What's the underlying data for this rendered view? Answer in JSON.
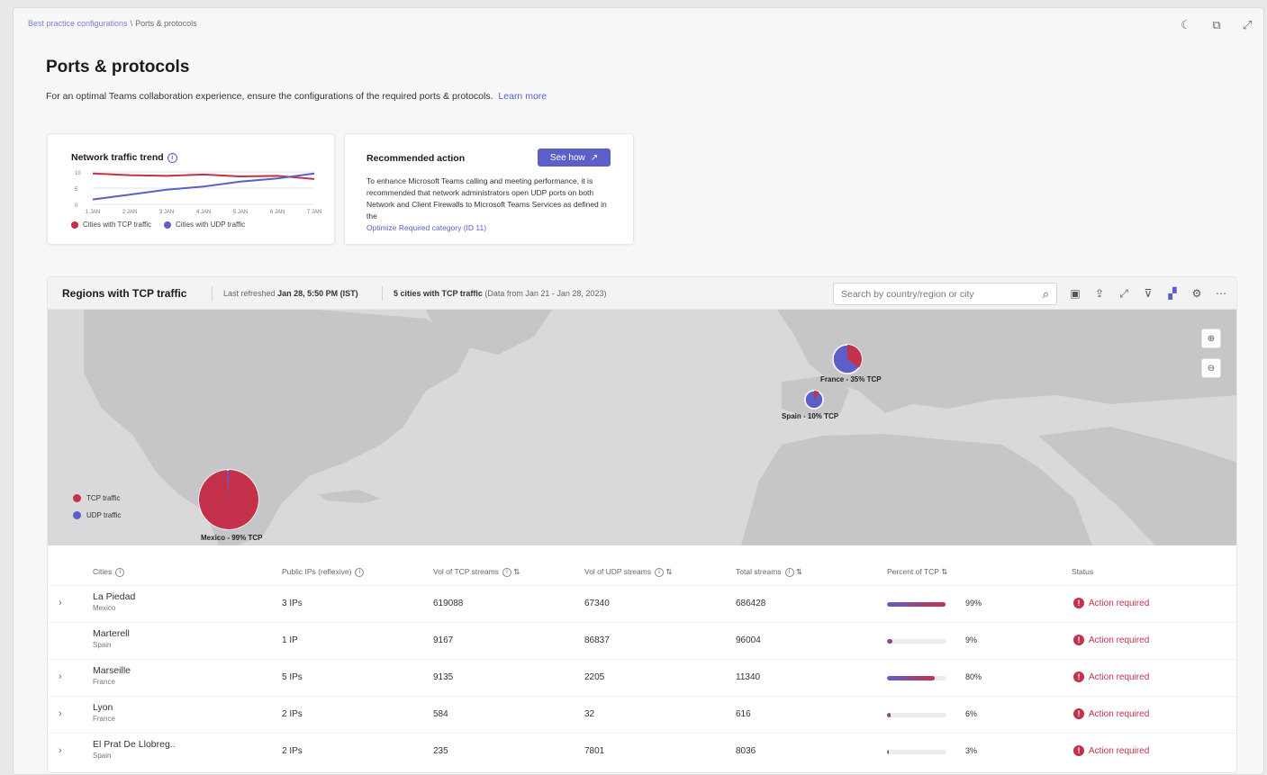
{
  "colors": {
    "tcp": "#c4314b",
    "udp": "#5b5fc7",
    "accent": "#5b5fc7"
  },
  "breadcrumb": {
    "parent": "Best practice configurations",
    "separator": "\\",
    "current": "Ports & protocols"
  },
  "window_icons": [
    "moon-icon",
    "restore-icon",
    "expand-icon"
  ],
  "page": {
    "title": "Ports & protocols",
    "description": "For an optimal Teams collaboration experience, ensure the configurations of the required ports & protocols.",
    "learn_more": "Learn more"
  },
  "trend_card": {
    "title": "Network traffic trend",
    "y_ticks": [
      "10",
      "5",
      "0"
    ],
    "x_ticks": [
      "1 JAN",
      "2 JAN",
      "3 JAN",
      "4 JAN",
      "5 JAN",
      "6 JAN",
      "7 JAN"
    ],
    "legend_tcp": "Cities with TCP traffic",
    "legend_udp": "Cities with UDP traffic"
  },
  "chart_data": {
    "type": "line",
    "title": "Network traffic trend",
    "x": [
      "1 JAN",
      "2 JAN",
      "3 JAN",
      "4 JAN",
      "5 JAN",
      "6 JAN",
      "7 JAN"
    ],
    "ylim": [
      0,
      10
    ],
    "series": [
      {
        "name": "Cities with TCP traffic",
        "values": [
          9.5,
          9.0,
          8.8,
          9.2,
          8.6,
          8.8,
          7.8
        ]
      },
      {
        "name": "Cities with UDP traffic",
        "values": [
          1.5,
          3.0,
          4.5,
          5.5,
          7.0,
          8.0,
          9.5
        ]
      }
    ]
  },
  "rec_card": {
    "title": "Recommended action",
    "button": "See how",
    "text": "To enhance Microsoft Teams calling and meeting performance, it is recommended that network administrators open UDP ports on both Network and Client Firewalls to Microsoft Teams Services as defined in the",
    "link": "Optimize Required category (ID 11)"
  },
  "regions": {
    "title": "Regions with TCP traffic",
    "refreshed_label": "Last refreshed",
    "refreshed_value": "Jan 28, 5:50 PM (IST)",
    "cities_summary": "5 cities with TCP traffic",
    "date_range": "(Data from Jan 21 - Jan 28, 2023)",
    "search_placeholder": "Search by country/region or city",
    "map_legend_tcp": "TCP traffic",
    "map_legend_udp": "UDP traffic",
    "pies": [
      {
        "label": "Mexico - 99% TCP",
        "tcp_fraction": 0.99
      },
      {
        "label": "France - 35% TCP",
        "tcp_fraction": 0.35
      },
      {
        "label": "Spain - 10% TCP",
        "tcp_fraction": 0.1
      }
    ]
  },
  "table": {
    "headers": [
      "Cities",
      "Public IPs (reflexive)",
      "Vol of TCP streams",
      "Vol of UDP streams",
      "Total streams",
      "Percent of TCP",
      "Status"
    ],
    "rows": [
      {
        "city": "La Piedad",
        "country": "Mexico",
        "ips": "3 IPs",
        "tcp": "619088",
        "udp": "67340",
        "total": "686428",
        "pct_label": "99%",
        "pct": 0.99,
        "status": "Action required",
        "expandable": true
      },
      {
        "city": "Marterell",
        "country": "Spain",
        "ips": "1 IP",
        "tcp": "9167",
        "udp": "86837",
        "total": "96004",
        "pct_label": "9%",
        "pct": 0.09,
        "status": "Action required",
        "expandable": false
      },
      {
        "city": "Marseille",
        "country": "France",
        "ips": "5 IPs",
        "tcp": "9135",
        "udp": "2205",
        "total": "11340",
        "pct_label": "80%",
        "pct": 0.8,
        "status": "Action required",
        "expandable": true
      },
      {
        "city": "Lyon",
        "country": "France",
        "ips": "2 IPs",
        "tcp": "584",
        "udp": "32",
        "total": "616",
        "pct_label": "6%",
        "pct": 0.06,
        "status": "Action required",
        "expandable": true
      },
      {
        "city": "El Prat De Llobreg..",
        "country": "Spain",
        "ips": "2 IPs",
        "tcp": "235",
        "udp": "7801",
        "total": "8036",
        "pct_label": "3%",
        "pct": 0.03,
        "status": "Action required",
        "expandable": true
      }
    ]
  }
}
